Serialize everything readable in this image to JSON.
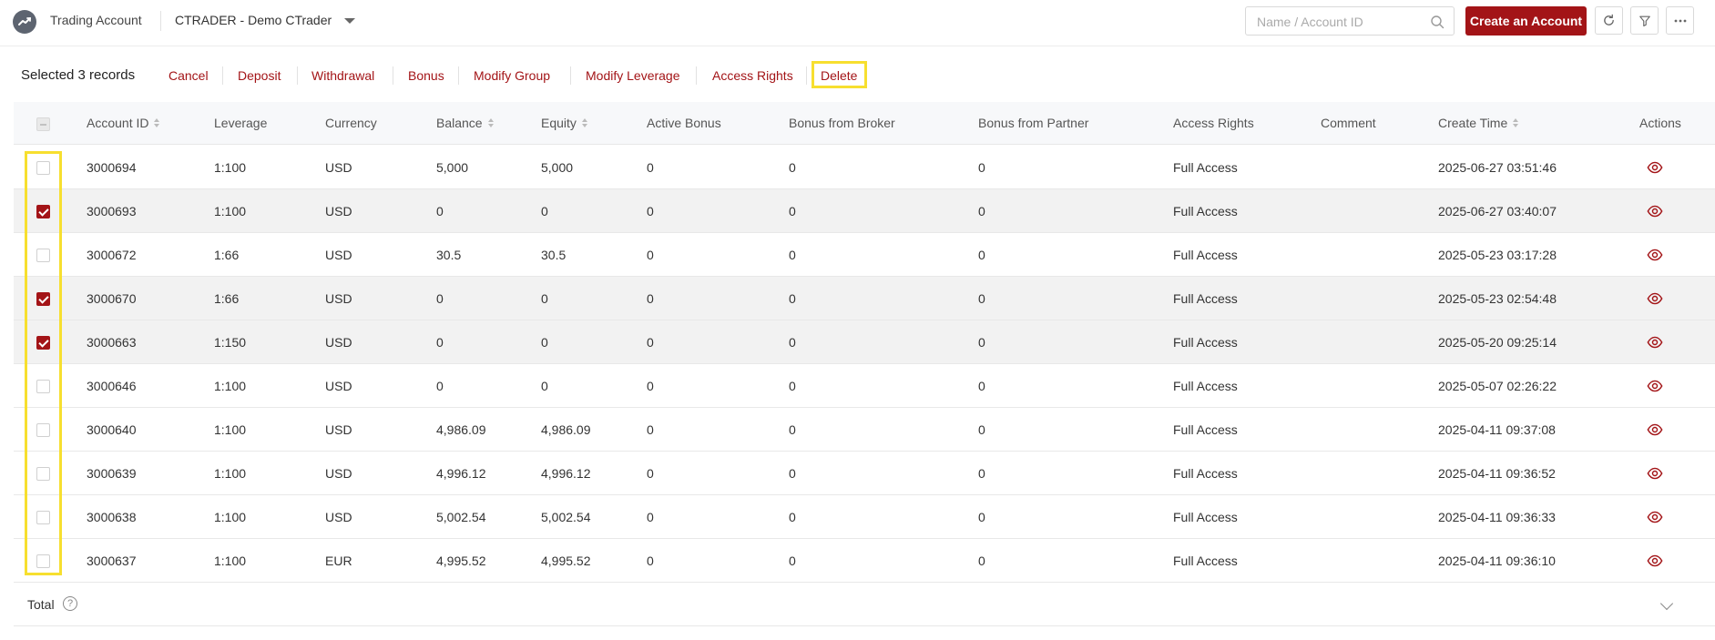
{
  "header": {
    "app_title": "Trading Account",
    "account_selector": "CTRADER - Demo CTrader",
    "search_placeholder": "Name / Account ID",
    "create_button": "Create an Account",
    "accent": "#a31417"
  },
  "toolbar": {
    "selected_text": "Selected 3 records",
    "actions": [
      "Cancel",
      "Deposit",
      "Withdrawal",
      "Bonus",
      "Modify Group",
      "Modify Leverage",
      "Access Rights",
      "Delete"
    ]
  },
  "table": {
    "columns": [
      "Account ID",
      "Leverage",
      "Currency",
      "Balance",
      "Equity",
      "Active Bonus",
      "Bonus from Broker",
      "Bonus from Partner",
      "Access Rights",
      "Comment",
      "Create Time",
      "Actions"
    ],
    "rows": [
      {
        "selected": false,
        "account_id": "3000694",
        "leverage": "1:100",
        "currency": "USD",
        "balance": "5,000",
        "equity": "5,000",
        "active_bonus": "0",
        "bonus_broker": "0",
        "bonus_partner": "0",
        "access": "Full Access",
        "comment": "",
        "create_time": "2025-06-27 03:51:46"
      },
      {
        "selected": true,
        "account_id": "3000693",
        "leverage": "1:100",
        "currency": "USD",
        "balance": "0",
        "equity": "0",
        "active_bonus": "0",
        "bonus_broker": "0",
        "bonus_partner": "0",
        "access": "Full Access",
        "comment": "",
        "create_time": "2025-06-27 03:40:07"
      },
      {
        "selected": false,
        "account_id": "3000672",
        "leverage": "1:66",
        "currency": "USD",
        "balance": "30.5",
        "equity": "30.5",
        "active_bonus": "0",
        "bonus_broker": "0",
        "bonus_partner": "0",
        "access": "Full Access",
        "comment": "",
        "create_time": "2025-05-23 03:17:28"
      },
      {
        "selected": true,
        "account_id": "3000670",
        "leverage": "1:66",
        "currency": "USD",
        "balance": "0",
        "equity": "0",
        "active_bonus": "0",
        "bonus_broker": "0",
        "bonus_partner": "0",
        "access": "Full Access",
        "comment": "",
        "create_time": "2025-05-23 02:54:48"
      },
      {
        "selected": true,
        "account_id": "3000663",
        "leverage": "1:150",
        "currency": "USD",
        "balance": "0",
        "equity": "0",
        "active_bonus": "0",
        "bonus_broker": "0",
        "bonus_partner": "0",
        "access": "Full Access",
        "comment": "",
        "create_time": "2025-05-20 09:25:14"
      },
      {
        "selected": false,
        "account_id": "3000646",
        "leverage": "1:100",
        "currency": "USD",
        "balance": "0",
        "equity": "0",
        "active_bonus": "0",
        "bonus_broker": "0",
        "bonus_partner": "0",
        "access": "Full Access",
        "comment": "",
        "create_time": "2025-05-07 02:26:22"
      },
      {
        "selected": false,
        "account_id": "3000640",
        "leverage": "1:100",
        "currency": "USD",
        "balance": "4,986.09",
        "equity": "4,986.09",
        "active_bonus": "0",
        "bonus_broker": "0",
        "bonus_partner": "0",
        "access": "Full Access",
        "comment": "",
        "create_time": "2025-04-11 09:37:08"
      },
      {
        "selected": false,
        "account_id": "3000639",
        "leverage": "1:100",
        "currency": "USD",
        "balance": "4,996.12",
        "equity": "4,996.12",
        "active_bonus": "0",
        "bonus_broker": "0",
        "bonus_partner": "0",
        "access": "Full Access",
        "comment": "",
        "create_time": "2025-04-11 09:36:52"
      },
      {
        "selected": false,
        "account_id": "3000638",
        "leverage": "1:100",
        "currency": "USD",
        "balance": "5,002.54",
        "equity": "5,002.54",
        "active_bonus": "0",
        "bonus_broker": "0",
        "bonus_partner": "0",
        "access": "Full Access",
        "comment": "",
        "create_time": "2025-04-11 09:36:33"
      },
      {
        "selected": false,
        "account_id": "3000637",
        "leverage": "1:100",
        "currency": "EUR",
        "balance": "4,995.52",
        "equity": "4,995.52",
        "active_bonus": "0",
        "bonus_broker": "0",
        "bonus_partner": "0",
        "access": "Full Access",
        "comment": "",
        "create_time": "2025-04-11 09:36:10"
      }
    ]
  },
  "footer": {
    "total_label": "Total",
    "help_glyph": "?"
  }
}
